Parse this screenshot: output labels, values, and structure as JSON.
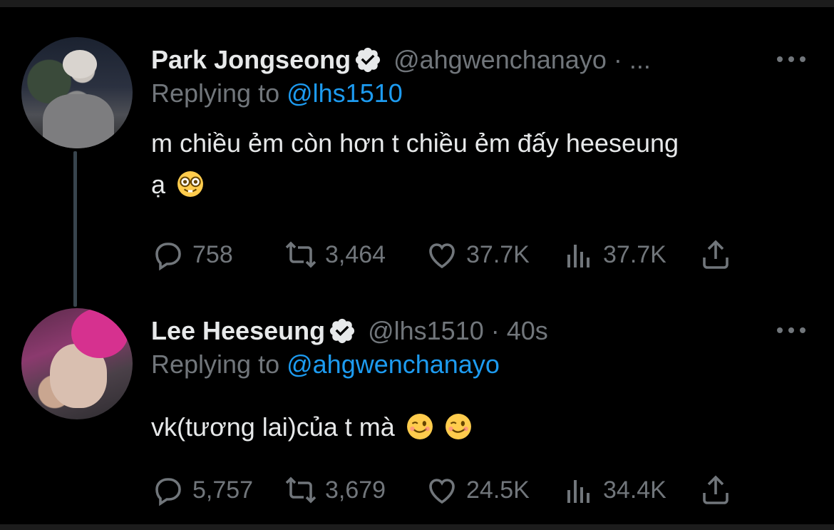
{
  "tweets": [
    {
      "name": "Park Jongseong",
      "handle": "@ahgwenchanayo",
      "separator": "·",
      "time": "...",
      "replying_prefix": "Replying to ",
      "replying_to": "@lhs1510",
      "text_line1": "m chiều ẻm còn hơn t chiều ẻm đấy heeseung",
      "text_line2": "ạ",
      "emojis": [
        "nerd-face"
      ],
      "stats": {
        "replies": "758",
        "retweets": "3,464",
        "likes": "37.7K",
        "views": "37.7K"
      }
    },
    {
      "name": "Lee Heeseung",
      "handle": "@lhs1510",
      "separator": "·",
      "time": "40s",
      "replying_prefix": "Replying to ",
      "replying_to": "@ahgwenchanayo",
      "text_line1": "vk(tương lai)của t mà",
      "emojis": [
        "winking-face",
        "winking-face"
      ],
      "stats": {
        "replies": "5,757",
        "retweets": "3,679",
        "likes": "24.5K",
        "views": "34.4K"
      }
    }
  ],
  "colors": {
    "background": "#000000",
    "text": "#e7e9ea",
    "muted": "#71767b",
    "link": "#1d9bf0",
    "thread_line": "#38444d"
  },
  "icons": [
    "verified-badge-icon",
    "more-icon",
    "reply-icon",
    "retweet-icon",
    "like-icon",
    "views-icon",
    "share-icon"
  ]
}
